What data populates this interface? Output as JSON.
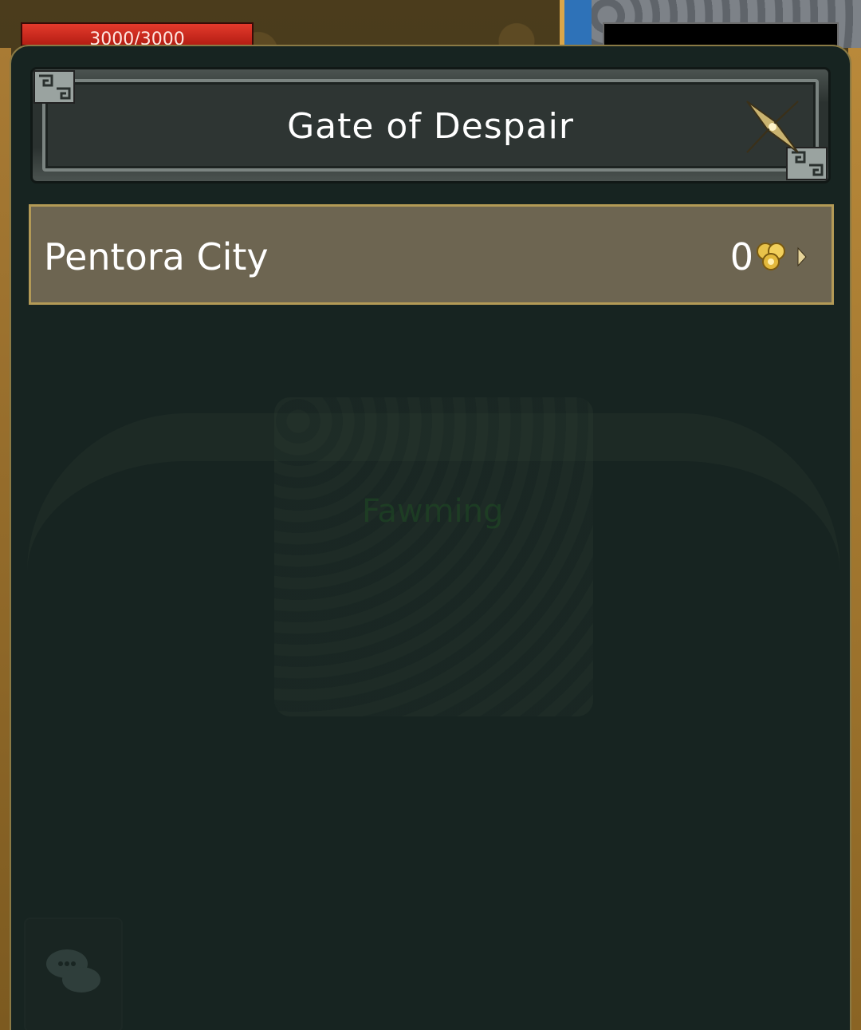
{
  "hud": {
    "hp_text": "3000/3000"
  },
  "world": {
    "ghost_name": "Fawming"
  },
  "dialog": {
    "title": "Gate of Despair",
    "close_icon": "close-x-icon",
    "destinations": [
      {
        "name": "Pentora City",
        "cost": "0",
        "cost_icon": "gold-coins-icon",
        "arrow_icon": "chevron-right-icon"
      }
    ]
  },
  "colors": {
    "dialog_bg": "#172421",
    "row_bg": "#6d6551",
    "row_border": "#b39a56",
    "hp_red": "#d8261c"
  }
}
